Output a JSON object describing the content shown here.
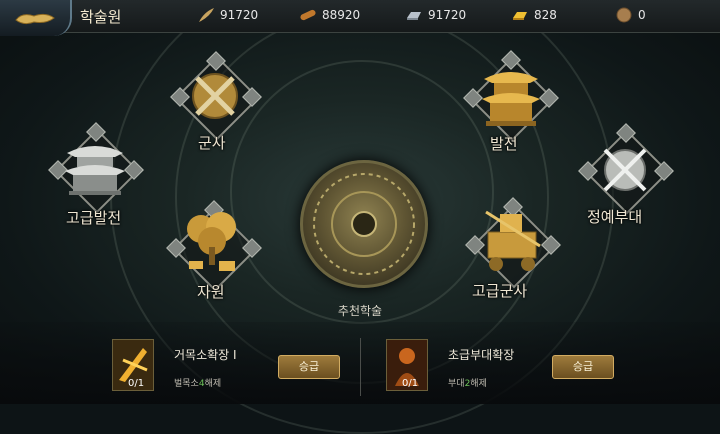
{
  "header": {
    "title": "학술원",
    "resources": [
      {
        "icon": "feather-icon",
        "value": "91720"
      },
      {
        "icon": "wood-log-icon",
        "value": "88920"
      },
      {
        "icon": "iron-ingot-icon",
        "value": "91720"
      },
      {
        "icon": "gold-ingot-icon",
        "value": "828"
      },
      {
        "icon": "coin-icon",
        "value": "0"
      }
    ]
  },
  "tree": {
    "military": "군사",
    "development": "발전",
    "advanced_development": "고급발전",
    "elite_troops": "정예부대",
    "resources": "자원",
    "advanced_military": "고급군사",
    "recommended": "추천학술"
  },
  "recommendations": [
    {
      "name": "거목소확장 I",
      "count": "0/1",
      "req_prefix": "벌목소",
      "req_level": "4",
      "req_suffix": "해제",
      "button": "승급"
    },
    {
      "name": "초급부대확장",
      "count": "0/1",
      "req_prefix": "부대",
      "req_level": "2",
      "req_suffix": "해제",
      "button": "승급"
    }
  ]
}
